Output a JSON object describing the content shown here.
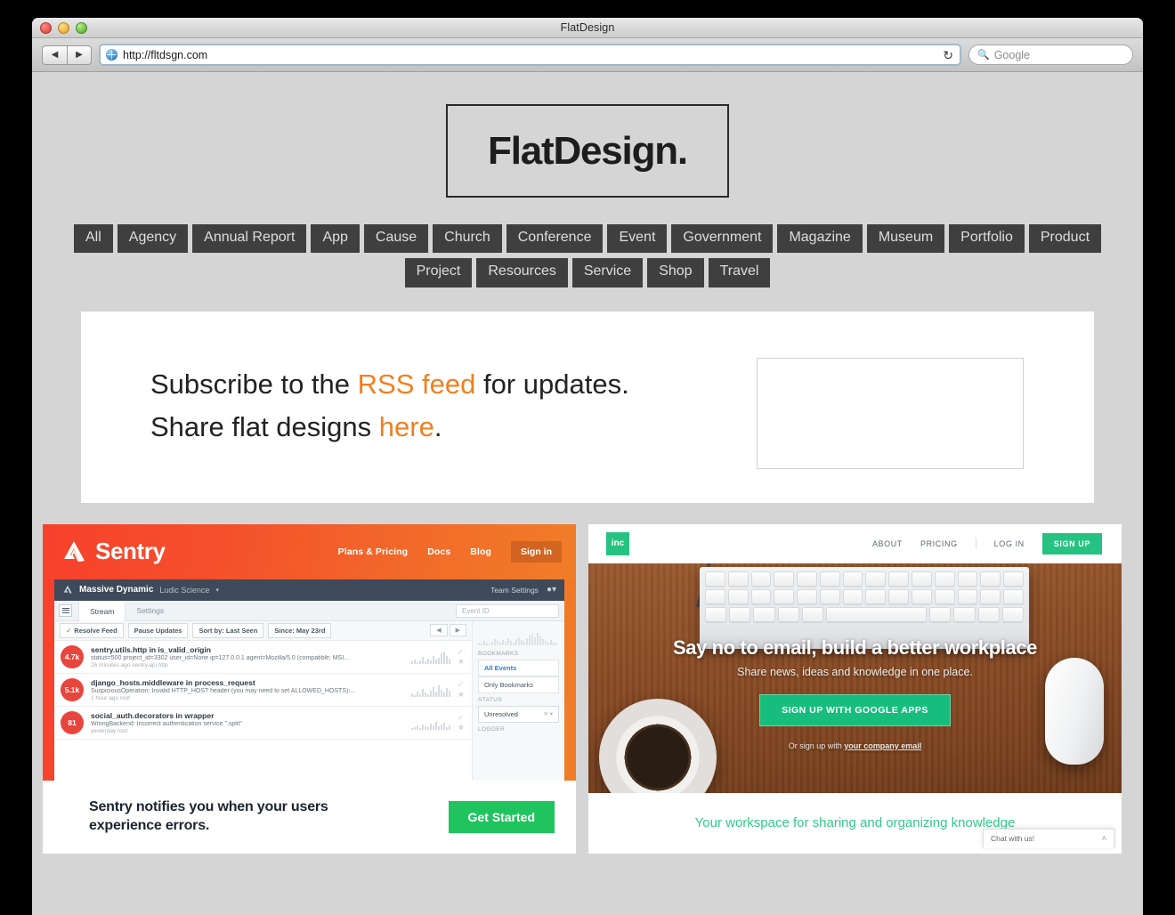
{
  "window": {
    "title": "FlatDesign",
    "traffic_lights": [
      "close",
      "minimize",
      "zoom"
    ]
  },
  "toolbar": {
    "back_label": "◀",
    "forward_label": "▶",
    "url": "http://fltdsgn.com",
    "reload_label": "↻",
    "search_icon": "🔍",
    "search_placeholder": "Google"
  },
  "site": {
    "logo": "FlatDesign.",
    "nav_row1": [
      "All",
      "Agency",
      "Annual Report",
      "App",
      "Cause",
      "Church",
      "Conference",
      "Event",
      "Government",
      "Magazine",
      "Museum",
      "Portfolio",
      "Product"
    ],
    "nav_row2": [
      "Project",
      "Resources",
      "Service",
      "Shop",
      "Travel"
    ],
    "subscribe": {
      "line1_a": "Subscribe to the ",
      "line1_link": "RSS feed",
      "line1_b": " for updates.",
      "line2_a": "Share flat designs ",
      "line2_link": "here",
      "line2_b": "."
    },
    "accent_color": "#f08020",
    "nav_bg_color": "#3f3f3f",
    "page_bg_color": "#d5d5d5"
  },
  "card_sentry": {
    "brand": "Sentry",
    "nav": [
      "Plans & Pricing",
      "Docs",
      "Blog"
    ],
    "signin": "Sign in",
    "app": {
      "org": "Massive Dynamic",
      "team": "Ludic Science",
      "caret": "▾",
      "team_settings": "Team Settings",
      "tabs": [
        "Stream",
        "Settings"
      ],
      "active_tab": "Stream",
      "event_id_placeholder": "Event ID",
      "filters": [
        {
          "label": "Resolve Feed",
          "check": "✓"
        },
        {
          "label": "Pause Updates",
          "check": ""
        },
        {
          "label": "Sort by: Last Seen",
          "check": ""
        },
        {
          "label": "Since: May 23rd",
          "check": ""
        }
      ],
      "pager_prev": "◀",
      "pager_next": "▶",
      "rows": [
        {
          "count": "4.7k",
          "title": "sentry.utils.http in is_valid_origin",
          "subtitle": "status=500 project_id=3302 user_id=None ip=127.0.0.1 agent=Mozilla/5.0 (compatible; MSI...",
          "meta": "26 minutes ago   sentry.api.http"
        },
        {
          "count": "5.1k",
          "title": "django_hosts.middleware in process_request",
          "subtitle": "SuspiciousOperation: Invalid HTTP_HOST header (you may need to set ALLOWED_HOSTS):...",
          "meta": "1 hour ago   root"
        },
        {
          "count": "81",
          "title": "social_auth.decorators in wrapper",
          "subtitle": "WrongBackend: Incorrect authentication service \".split\"",
          "meta": "yesterday   root"
        }
      ],
      "sidebar": {
        "bookmarks_header": "BOOKMARKS",
        "bookmarks_options": [
          "All Events",
          "Only Bookmarks"
        ],
        "status_header": "STATUS",
        "status_value": "Unresolved",
        "logger_header": "LOGGER"
      }
    },
    "tagline_line1": "Sentry notifies you when your users",
    "tagline_line2": "experience errors.",
    "cta": "Get Started",
    "cta_color": "#20c45e"
  },
  "card_inc": {
    "logo": "inc",
    "nav": [
      "ABOUT",
      "PRICING"
    ],
    "login": "LOG IN",
    "signup": "SIGN UP",
    "hero_title": "Say no to email, build a better workplace",
    "hero_subtitle": "Share news, ideas and knowledge in one place.",
    "hero_cta": "SIGN UP WITH GOOGLE APPS",
    "hero_alt_prefix": "Or sign up with ",
    "hero_alt_link": "your company email",
    "footer_text": "Your workspace for sharing and organizing knowledge",
    "chat_label": "Chat with us!",
    "chat_caret": "˄",
    "brand_color": "#26c281"
  }
}
